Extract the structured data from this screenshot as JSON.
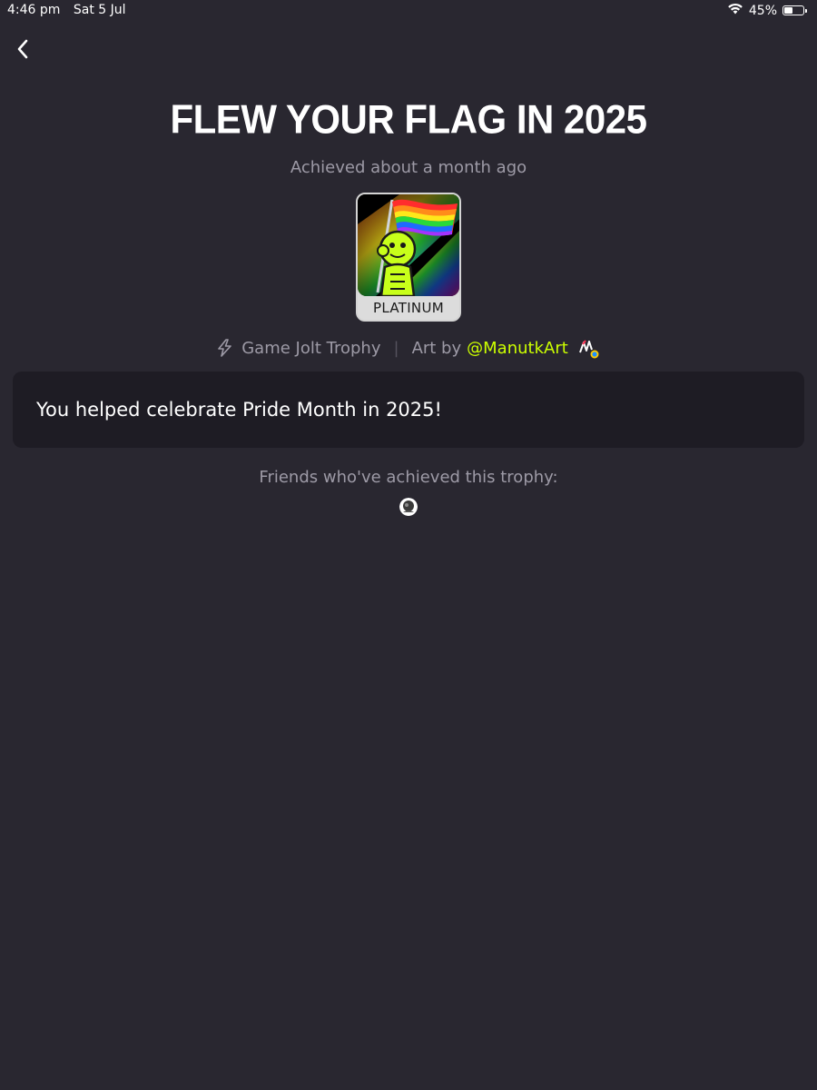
{
  "status_bar": {
    "time": "4:46 pm",
    "date": "Sat 5 Jul",
    "battery": "45%",
    "battery_level": 0.45
  },
  "header": {
    "back_icon": "chevron-left-icon"
  },
  "trophy": {
    "title": "FLEW YOUR FLAG IN 2025",
    "achieved": "Achieved about a month ago",
    "tier": "PLATINUM",
    "source": "Game Jolt Trophy",
    "art_by_label": "Art by",
    "artist": "@ManutkArt",
    "description": "You helped celebrate Pride Month in 2025!"
  },
  "friends": {
    "label": "Friends who've achieved this trophy:"
  },
  "colors": {
    "background": "#292730",
    "card": "#1e1c24",
    "muted_text": "#9d9aa6",
    "accent": "#ccff00"
  }
}
